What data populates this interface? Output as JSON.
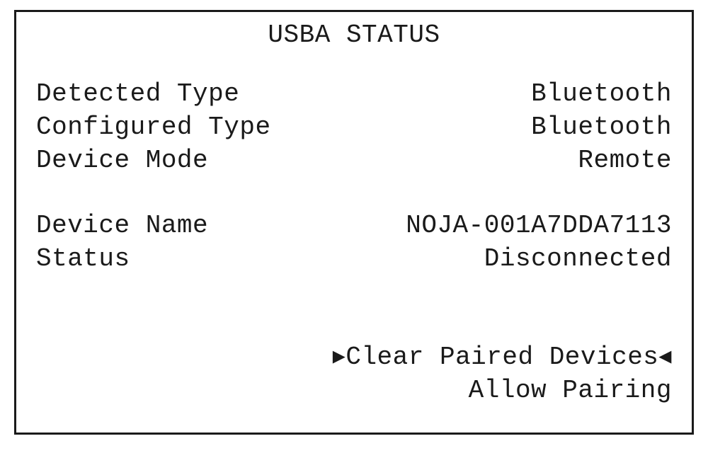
{
  "title": "USBA STATUS",
  "fields": {
    "detected_type": {
      "label": "Detected Type",
      "value": "Bluetooth"
    },
    "configured_type": {
      "label": "Configured Type",
      "value": "Bluetooth"
    },
    "device_mode": {
      "label": "Device Mode",
      "value": "Remote"
    },
    "device_name": {
      "label": "Device Name",
      "value": "NOJA-001A7DDA7113"
    },
    "status": {
      "label": "Status",
      "value": "Disconnected"
    }
  },
  "menu": {
    "clear_paired": "Clear Paired Devices",
    "allow_pairing": "Allow Pairing"
  },
  "selection_markers": {
    "left": "▸",
    "right": "◂"
  }
}
